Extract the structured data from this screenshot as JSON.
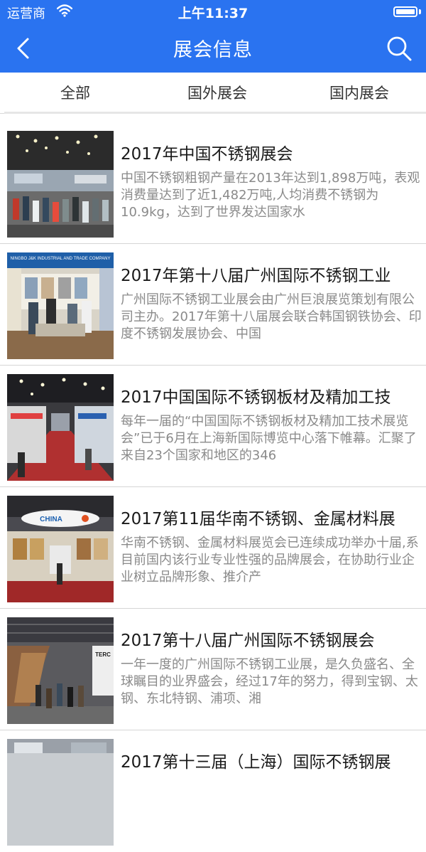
{
  "status_bar": {
    "carrier": "运营商",
    "time": "上午11:37"
  },
  "nav": {
    "title": "展会信息",
    "back_icon": "chevron-left-icon",
    "search_icon": "search-icon"
  },
  "tabs": [
    {
      "label": "全部"
    },
    {
      "label": "国外展会"
    },
    {
      "label": "国内展会"
    }
  ],
  "items": [
    {
      "title": "2017年中国不锈钢展会",
      "desc": "中国不锈钢粗钢产量在2013年达到1,898万吨，表观消费量达到了近1,482万吨,人均消费不锈钢为10.9kg，达到了世界发达国家水"
    },
    {
      "title": "2017年第十八届广州国际不锈钢工业",
      "desc": "广州国际不锈钢工业展会由广州巨浪展览策划有限公司主办。2017年第十八届展会联合韩国钢铁协会、印度不锈钢发展协会、中国",
      "thumb_sign": "NINGBO J&K INDUSTRIAL AND TRADE COMPANY"
    },
    {
      "title": "2017中国国际不锈钢板材及精加工技",
      "desc": "每年一届的“中国国际不锈钢板材及精加工技术展览会”已于6月在上海新国际博览中心落下帷幕。汇聚了来自23个国家和地区的346"
    },
    {
      "title": "2017第11届华南不锈钢、金属材料展",
      "desc": "华南不锈钢、金属材料展览会已连续成功举办十届,系目前国内该行业专业性强的品牌展会，在协助行业企业树立品牌形象、推介产",
      "thumb_sign": "CHINA"
    },
    {
      "title": "2017第十八届广州国际不锈钢展会",
      "desc": "一年一度的广州国际不锈钢工业展，是久负盛名、全球瞩目的业界盛会，经过17年的努力，得到宝钢、太钢、东北特钢、浦项、湘",
      "thumb_sign": "TERC"
    },
    {
      "title": "2017第十三届（上海）国际不锈钢展",
      "desc": ""
    }
  ]
}
